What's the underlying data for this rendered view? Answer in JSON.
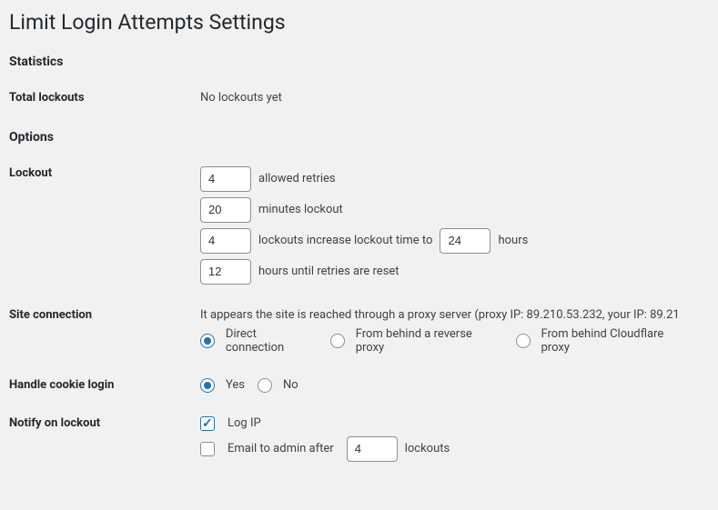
{
  "page": {
    "title": "Limit Login Attempts Settings"
  },
  "statistics": {
    "heading": "Statistics",
    "total_lockouts_label": "Total lockouts",
    "total_lockouts_value": "No lockouts yet"
  },
  "options": {
    "heading": "Options",
    "lockout": {
      "label": "Lockout",
      "allowed_retries_value": "4",
      "allowed_retries_text": "allowed retries",
      "minutes_lockout_value": "20",
      "minutes_lockout_text": "minutes lockout",
      "lockouts_increase_value": "4",
      "lockouts_increase_text_before": "lockouts increase lockout time to",
      "lockouts_increase_hours_value": "24",
      "lockouts_increase_text_after": "hours",
      "reset_hours_value": "12",
      "reset_hours_text": "hours until retries are reset"
    },
    "site_connection": {
      "label": "Site connection",
      "proxy_note": "It appears the site is reached through a proxy server (proxy IP: 89.210.53.232, your IP: 89.21",
      "direct_label": "Direct connection",
      "reverse_proxy_label": "From behind a reverse proxy",
      "cloudflare_label": "From behind Cloudflare proxy"
    },
    "cookie_login": {
      "label": "Handle cookie login",
      "yes_label": "Yes",
      "no_label": "No"
    },
    "notify": {
      "label": "Notify on lockout",
      "log_ip_label": "Log IP",
      "email_admin_label_before": "Email to admin after",
      "email_admin_value": "4",
      "email_admin_label_after": "lockouts"
    }
  }
}
